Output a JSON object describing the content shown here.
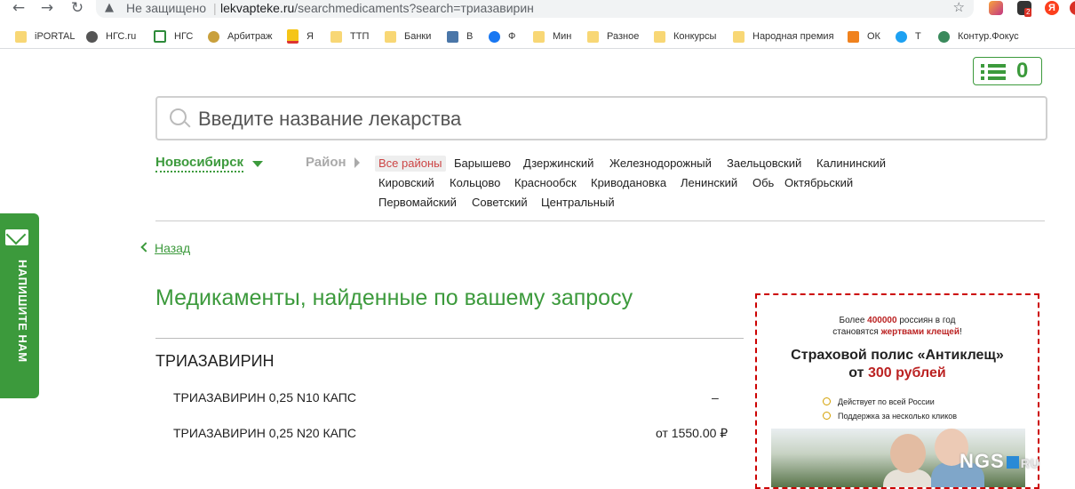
{
  "browser": {
    "security_label": "Не защищено",
    "url_host": "lekvapteke.ru",
    "url_path": "/searchmedicaments?search=триазавирин",
    "ext_badge": "2",
    "ext_yandex": "Я"
  },
  "bookmarks": [
    {
      "label": "iPORTAL",
      "icon": "folder-icon"
    },
    {
      "label": "НГС.ru",
      "icon": "globe-icon"
    },
    {
      "label": "НГС",
      "icon": "ngs-icon"
    },
    {
      "label": "Арбитраж",
      "icon": "emblem-icon"
    },
    {
      "label": "Я",
      "icon": "mail-icon"
    },
    {
      "label": "ТТП",
      "icon": "folder-icon"
    },
    {
      "label": "Банки",
      "icon": "folder-icon"
    },
    {
      "label": "В",
      "icon": "vk-icon"
    },
    {
      "label": "Ф",
      "icon": "facebook-icon"
    },
    {
      "label": "Мин",
      "icon": "folder-icon"
    },
    {
      "label": "Разное",
      "icon": "folder-icon"
    },
    {
      "label": "Конкурсы",
      "icon": "folder-icon"
    },
    {
      "label": "Народная премия",
      "icon": "folder-icon"
    },
    {
      "label": "ОК",
      "icon": "mail-icon"
    },
    {
      "label": "Т",
      "icon": "twitter-icon"
    },
    {
      "label": "Контур.Фокус",
      "icon": "kontur-icon"
    }
  ],
  "cart": {
    "count": "0"
  },
  "search": {
    "placeholder": "Введите название лекарства"
  },
  "location": {
    "city": "Новосибирск",
    "district_label": "Район",
    "districts": [
      "Все районы",
      "Барышево",
      "Дзержинский",
      "Железнодорожный",
      "Заельцовский",
      "Калининский",
      "Кировский",
      "Кольцово",
      "Краснообск",
      "Криводановка",
      "Ленинский",
      "Обь",
      "Октябрьский",
      "Первомайский",
      "Советский",
      "Центральный"
    ]
  },
  "back_label": "Назад",
  "results": {
    "title": "Медикаменты, найденные по вашему запросу",
    "group_name": "ТРИАЗАВИРИН",
    "items": [
      {
        "name": "ТРИАЗАВИРИН 0,25 N10 КАПС",
        "price": "–"
      },
      {
        "name": "ТРИАЗАВИРИН 0,25 N20 КАПС",
        "price": "от 1550.00 ₽"
      }
    ]
  },
  "ad": {
    "line1_pre": "Более ",
    "line1_num": "400000",
    "line1_post": " россиян в год",
    "line2_pre": "становятся ",
    "line2_hl": "жертвами клещей",
    "line2_post": "!",
    "headline": "Страховой полис «Антиклещ»",
    "price_pre": "от ",
    "price_hl": "300 рублей",
    "bullet1": "Действует по всей России",
    "bullet2": "Поддержка за несколько кликов"
  },
  "watermark": {
    "brand": "NGS",
    "suffix": "RU"
  },
  "feedback_label": "НАПИШИТЕ НАМ",
  "colors": {
    "accent": "#3c9a3c",
    "ad_border": "#cc0000",
    "ad_highlight": "#b22222"
  }
}
